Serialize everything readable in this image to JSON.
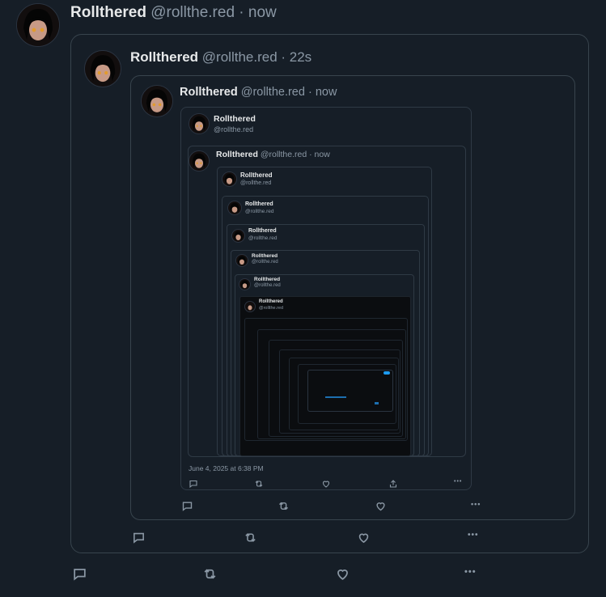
{
  "post": {
    "name": "Rollthered",
    "handle": "@rollthe.red",
    "time": "· now"
  },
  "quote1": {
    "name": "Rollthered",
    "handle": "@rollthe.red",
    "time": "· 22s"
  },
  "quote2": {
    "name": "Rollthered",
    "handle": "@rollthe.red",
    "time": "· now"
  },
  "quote3": {
    "name": "Rollthered",
    "handle": "@rollthe.red",
    "date": "June 4, 2025 at 6:38 PM"
  },
  "quote4": {
    "name": "Rollthered",
    "handle": "@rollthe.red",
    "time": "· now"
  },
  "nested": [
    {
      "name": "Rollthered",
      "handle": "@rollthe.red"
    },
    {
      "name": "Rollthered",
      "handle": "@rollthe.red"
    },
    {
      "name": "Rollthered",
      "handle": "@rollthe.red"
    },
    {
      "name": "Rollthered",
      "handle": "@rollthe.red"
    },
    {
      "name": "Rollthered",
      "handle": "@rollthe.red"
    },
    {
      "name": "Rollthered",
      "handle": "@rollthe.red"
    }
  ],
  "actions": {
    "more": "•••"
  },
  "icons": [
    "reply-icon",
    "repost-icon",
    "like-icon",
    "share-icon",
    "more-icon"
  ]
}
